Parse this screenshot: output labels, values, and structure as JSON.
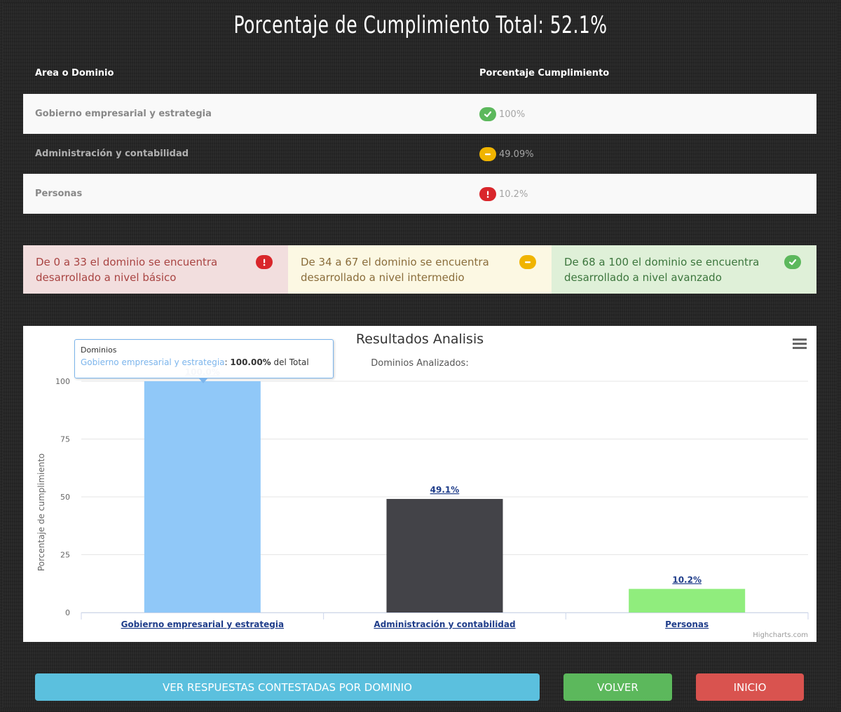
{
  "page": {
    "title": "Porcentaje de Cumplimiento Total: 52.1%"
  },
  "table": {
    "headers": [
      "Area o Dominio",
      "Porcentaje Cumplimiento"
    ],
    "rows": [
      {
        "area": "Gobierno empresarial y estrategia",
        "percent": "100%",
        "status": "check-icon"
      },
      {
        "area": "Administración y contabilidad",
        "percent": "49.09%",
        "status": "minus-icon"
      },
      {
        "area": "Personas",
        "percent": "10.2%",
        "status": "exclamation-icon"
      }
    ]
  },
  "legend": [
    {
      "text": "De 0 a 33 el dominio se encuentra desarrollado a nivel básico",
      "icon": "exclamation-icon",
      "color": "#d9262b"
    },
    {
      "text": "De 34 a 67 el dominio se encuentra desarrollado a nivel intermedio",
      "icon": "minus-icon",
      "color": "#f0b400"
    },
    {
      "text": "De 68 a 100 el dominio se encuentra desarrollado a nivel avanzado",
      "icon": "check-icon",
      "color": "#5cb85c"
    }
  ],
  "chart_data": {
    "type": "bar",
    "title": "Resultados Analisis",
    "subtitle": "Dominios Analizados:",
    "ylabel": "Porcentaje de cumplimiento",
    "ylim": [
      0,
      100
    ],
    "yticks": [
      0,
      25,
      50,
      75,
      100
    ],
    "grid": true,
    "categories": [
      "Gobierno empresarial y estrategia",
      "Administración y contabilidad",
      "Personas"
    ],
    "values": [
      100.0,
      49.1,
      10.2
    ],
    "data_labels": [
      "100.0%",
      "49.1%",
      "10.2%"
    ],
    "colors": [
      "#90c8f8",
      "#434348",
      "#90ed7d"
    ],
    "tooltip": {
      "header": "Dominios",
      "name": "Gobierno empresarial y estrategia",
      "value": "100.00%",
      "suffix": "del Total"
    },
    "credits": "Highcharts.com"
  },
  "buttons": {
    "responses": "VER RESPUESTAS CONTESTADAS POR DOMINIO",
    "back": "VOLVER",
    "home": "INICIO"
  },
  "colors": {
    "info": "#5bc0de",
    "success": "#5cb85c",
    "danger": "#d9534f"
  }
}
